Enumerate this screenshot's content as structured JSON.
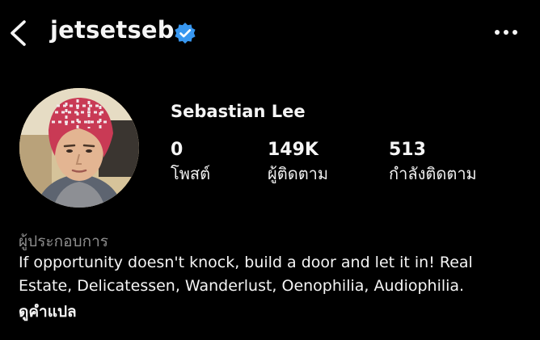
{
  "header": {
    "username": "jetsetseb",
    "back_icon": "chevron-left-icon",
    "verified_icon": "verified-badge-icon",
    "more_icon": "more-horizontal-icon",
    "verified_color": "#3897f0"
  },
  "profile": {
    "full_name": "Sebastian Lee",
    "avatar": "profile-photo",
    "stats": [
      {
        "value": "0",
        "label": "โพสต์"
      },
      {
        "value": "149K",
        "label": "ผู้ติดตาม"
      },
      {
        "value": "513",
        "label": "กำลังติดตาม"
      }
    ],
    "category": "ผู้ประกอบการ",
    "bio_line1": "If opportunity doesn't knock, build a door and let it in! Real",
    "bio_line2": "Estate, Delicatessen, Wanderlust, Oenophilia, Audiophilia.",
    "translate_label": "ดูคำแปล"
  },
  "colors": {
    "background": "#000000",
    "text": "#f5f5f5",
    "muted": "#8e8e8e"
  }
}
